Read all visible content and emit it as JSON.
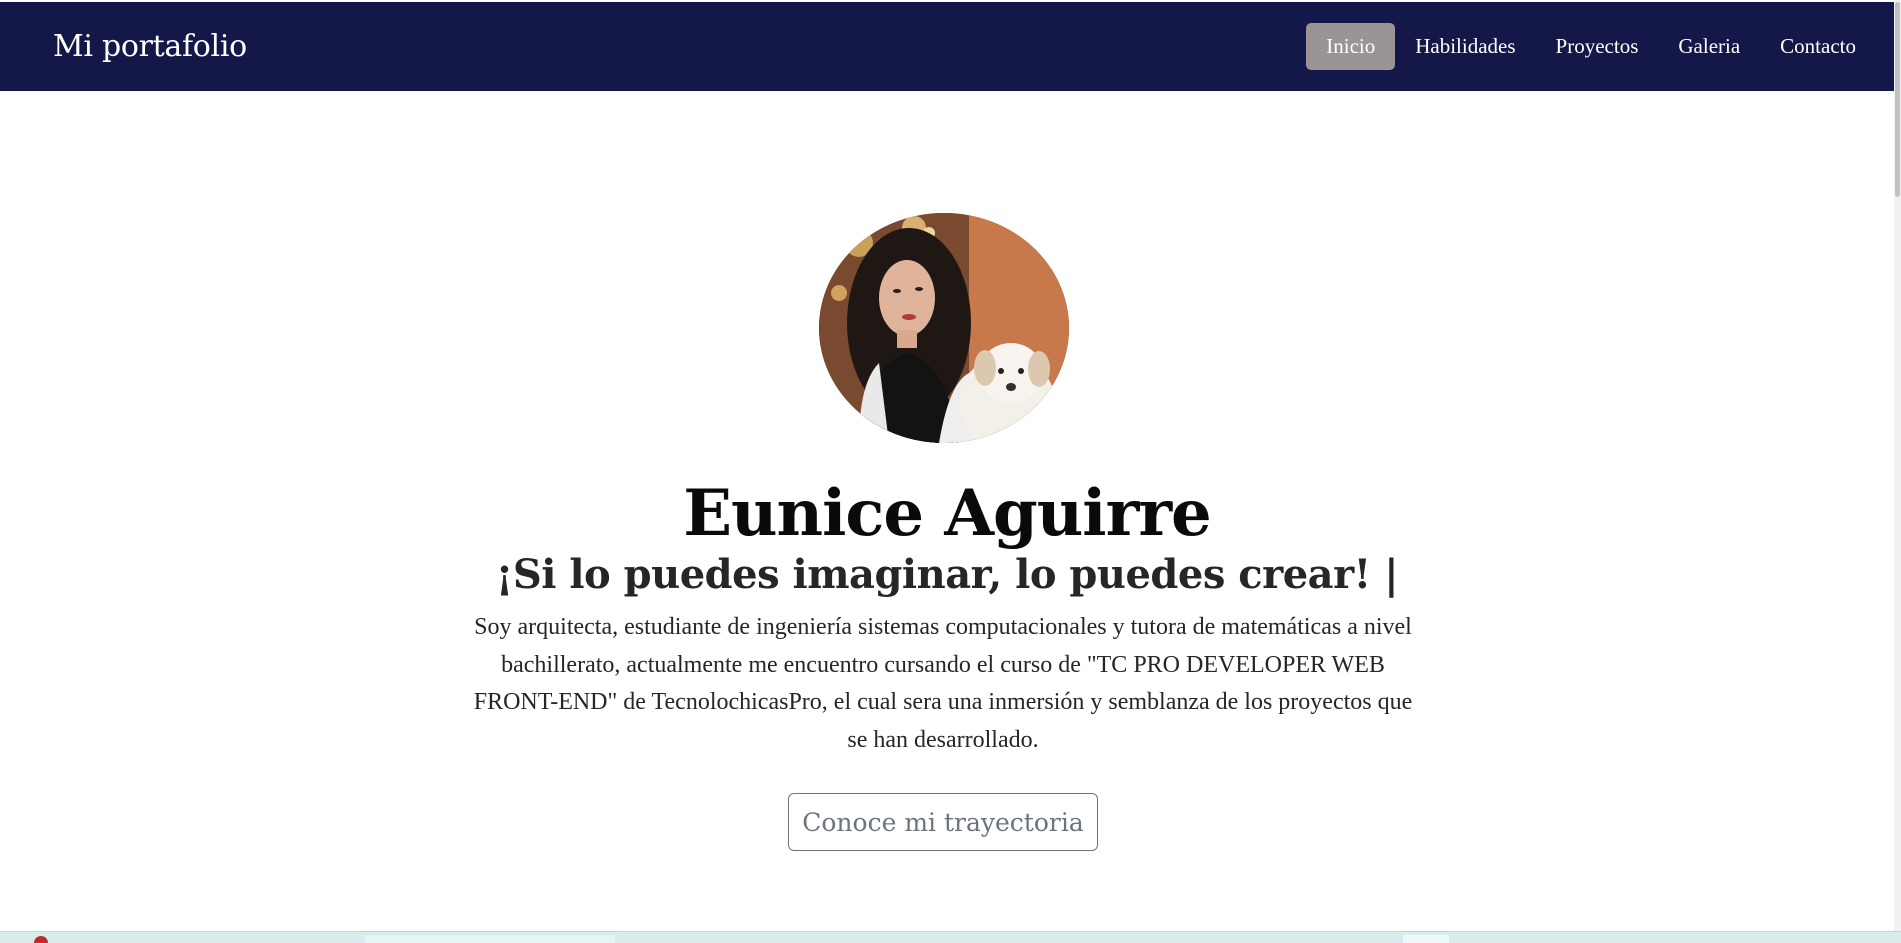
{
  "navbar": {
    "brand": "Mi portafolio",
    "links": [
      {
        "label": "Inicio",
        "active": true
      },
      {
        "label": "Habilidades",
        "active": false
      },
      {
        "label": "Proyectos",
        "active": false
      },
      {
        "label": "Galeria",
        "active": false
      },
      {
        "label": "Contacto",
        "active": false
      }
    ],
    "background": "#131848",
    "active_background": "#9b9494"
  },
  "hero": {
    "avatar_icon": "profile-photo",
    "name": "Eunice Aguirre",
    "tagline": "¡Si lo puedes imaginar, lo puedes crear! |",
    "bio": "Soy arquitecta, estudiante de ingeniería sistemas computacionales y tutora de matemáticas a nivel bachillerato, actualmente me encuentro cursando el curso de \"TC PRO DEVELOPER WEB FRONT-END\" de TecnolochicasPro, el cual sera una inmersión y semblanza de los proyectos que se han desarrollado.",
    "cta_label": "Conoce mi trayectoria"
  }
}
